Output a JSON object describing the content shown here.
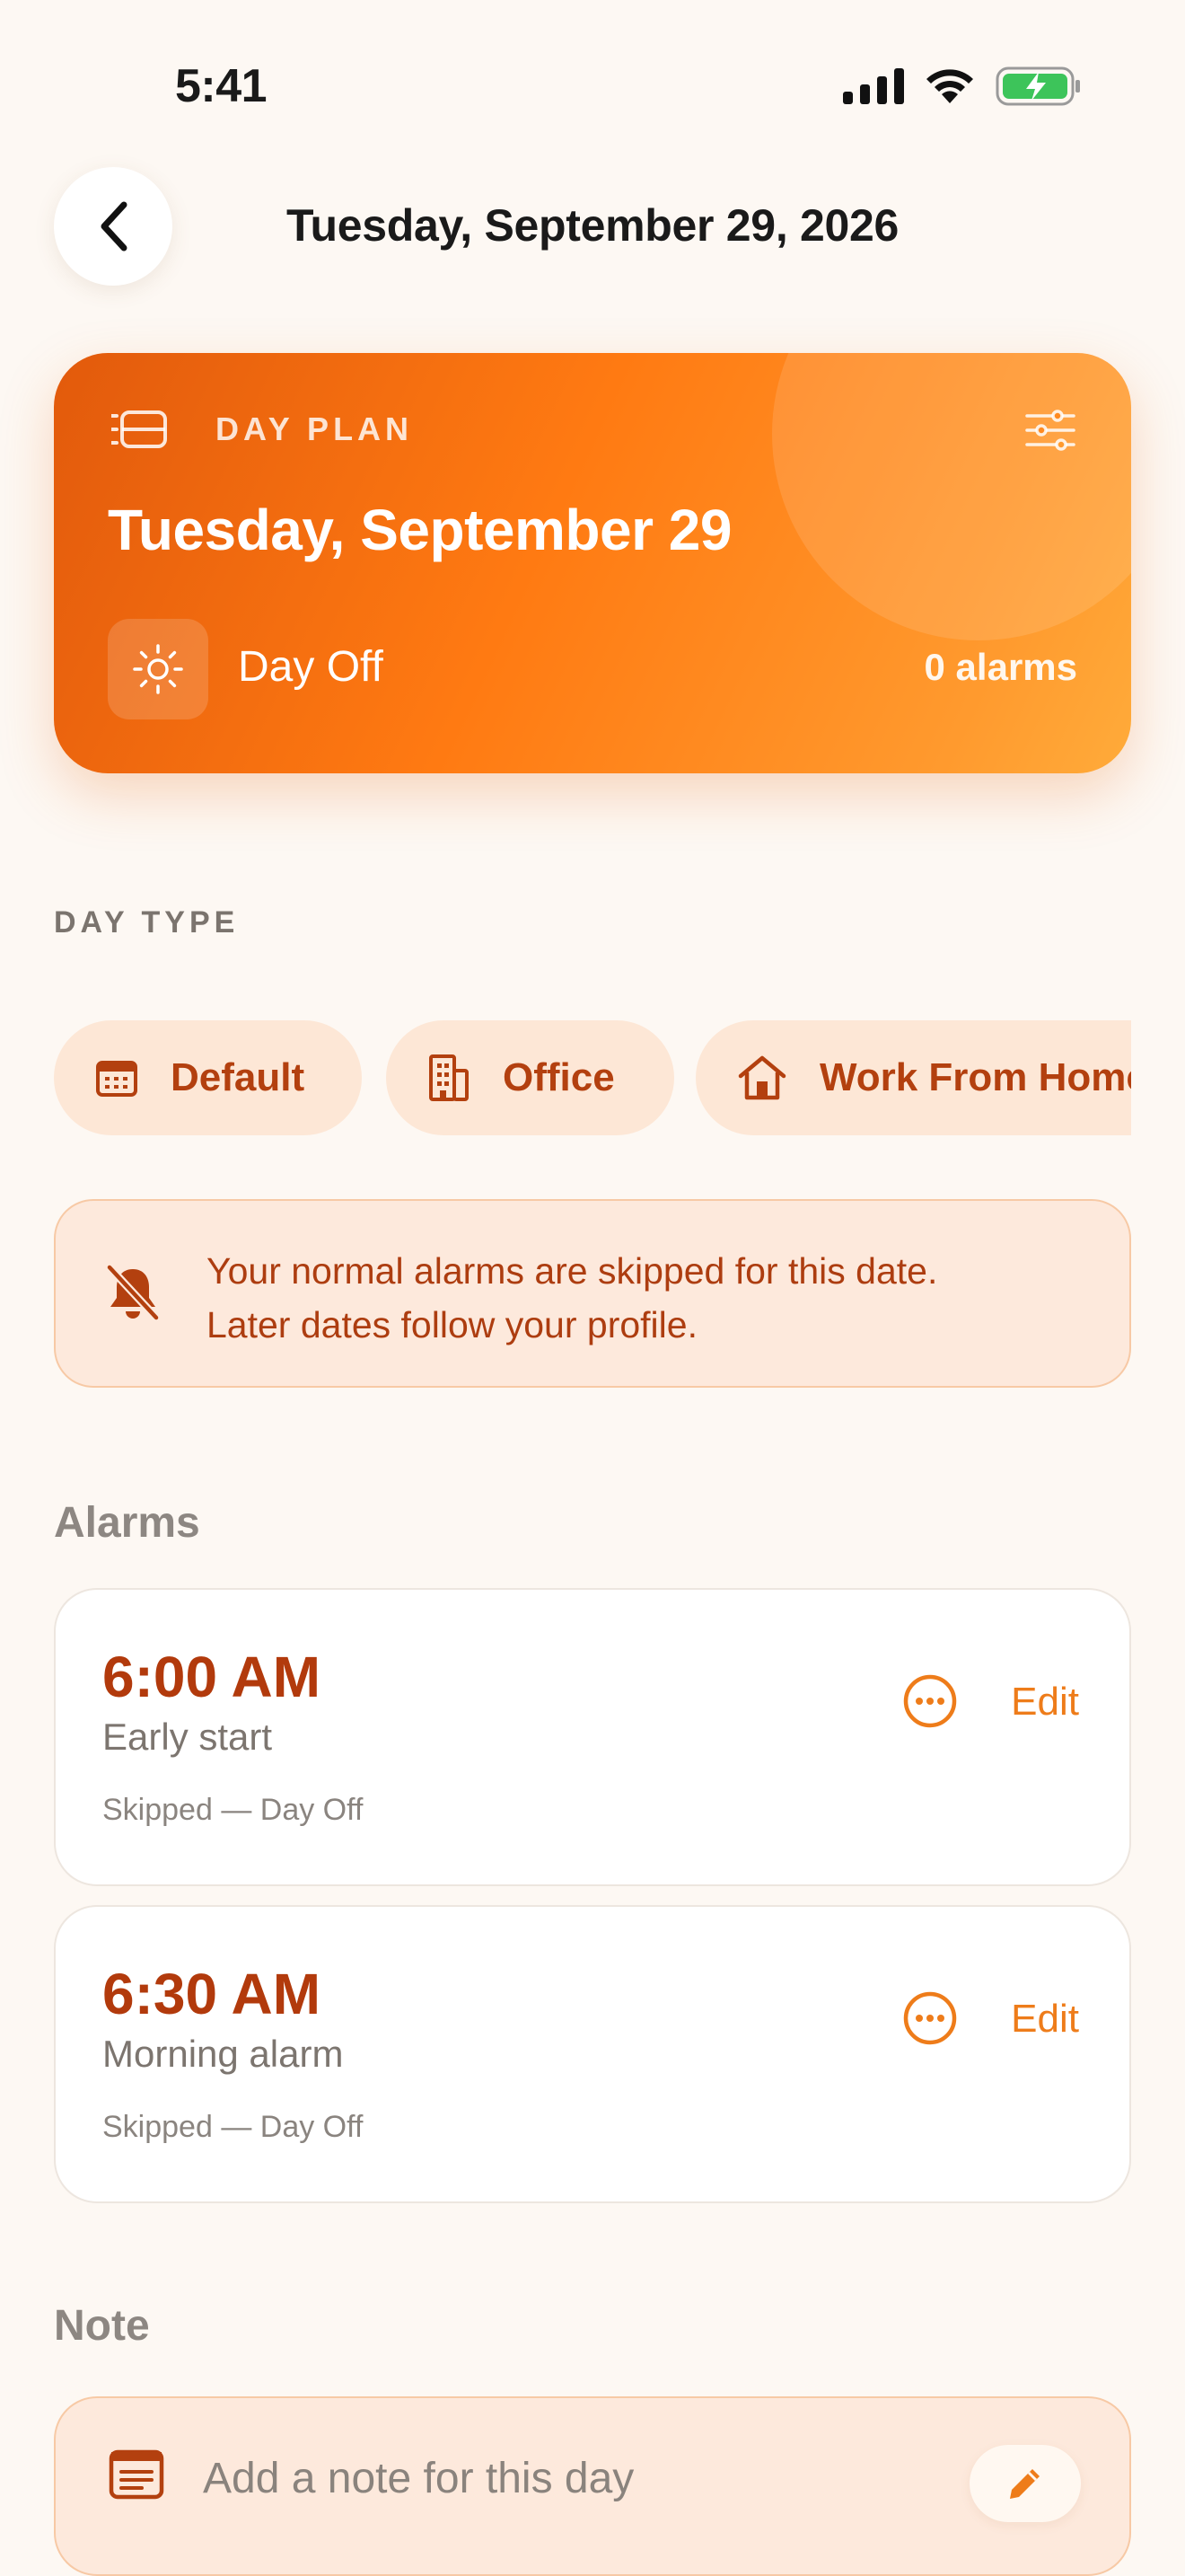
{
  "status_bar": {
    "time": "5:41"
  },
  "header": {
    "title": "Tuesday, September 29, 2026"
  },
  "hero": {
    "label": "DAY PLAN",
    "date": "Tuesday, September 29",
    "day_type": "Day Off",
    "alarm_count": "0 alarms",
    "gradient_start": "#e25a0c",
    "gradient_end": "#ffab3a"
  },
  "day_type_section": {
    "caption": "DAY TYPE",
    "options": [
      {
        "label": "Default",
        "icon": "calendar-icon"
      },
      {
        "label": "Office",
        "icon": "building-icon"
      },
      {
        "label": "Work From Home",
        "icon": "home-icon"
      }
    ]
  },
  "banner": {
    "line1": "Your normal alarms are skipped for this date.",
    "line2": "Later dates follow your profile.",
    "icon": "bell-slash-icon"
  },
  "alarms_section": {
    "title": "Alarms",
    "items": [
      {
        "time": "6:00 AM",
        "name": "Early start",
        "status": "Skipped — Day Off",
        "edit_label": "Edit"
      },
      {
        "time": "6:30 AM",
        "name": "Morning alarm",
        "status": "Skipped — Day Off",
        "edit_label": "Edit"
      }
    ]
  },
  "note_section": {
    "title": "Note",
    "placeholder": "Add a note for this day"
  },
  "colors": {
    "accent": "#ee7c1a",
    "accent_dark": "#b23a0c",
    "background": "#fdf8f3",
    "chip_bg": "#fde7d6"
  }
}
